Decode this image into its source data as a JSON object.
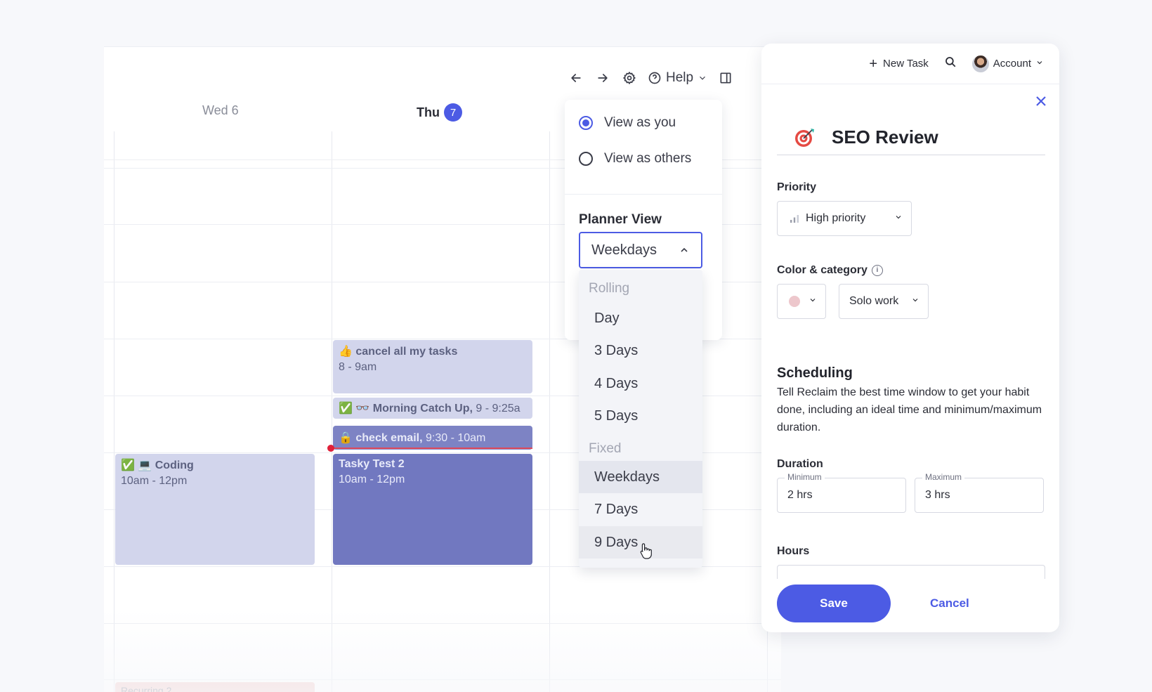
{
  "calendar": {
    "days": [
      {
        "name": "Wed 6"
      },
      {
        "name": "Thu",
        "badge": "7"
      }
    ],
    "events": [
      {
        "title": "👍 cancel all my tasks",
        "time": "8 - 9am"
      },
      {
        "title": "✅ 👓 Morning Catch Up,",
        "time": "9 - 9:25a"
      },
      {
        "title": "🔒 check email,",
        "time": "9:30 - 10am"
      },
      {
        "title": "Tasky Test 2",
        "time": "10am - 12pm"
      },
      {
        "title": "✅ 💻 Coding",
        "time": "10am - 12pm"
      },
      {
        "title": "Recurring 2"
      }
    ],
    "help_label": "Help",
    "icons": [
      "arrow-left-icon",
      "arrow-right-icon",
      "gear-icon",
      "question-circle-icon",
      "chevron-down-icon",
      "sidebar-panel-icon"
    ]
  },
  "view_popover": {
    "options": [
      {
        "label": "View as you",
        "selected": true
      },
      {
        "label": "View as others",
        "selected": false
      }
    ],
    "planner_label": "Planner View",
    "planner_value": "Weekdays"
  },
  "planner_dropdown": {
    "groups": [
      {
        "label": "Rolling",
        "items": [
          "Day",
          "3 Days",
          "4 Days",
          "5 Days"
        ]
      },
      {
        "label": "Fixed",
        "items": [
          "Weekdays",
          "7 Days",
          "9 Days"
        ]
      }
    ],
    "selected": "Weekdays",
    "hovered": "9 Days"
  },
  "panel": {
    "new_task": "New Task",
    "account": "Account",
    "task_title": "SEO Review",
    "task_icon": "target-dart-icon",
    "priority": {
      "label": "Priority",
      "value": "High priority"
    },
    "color_category": {
      "label": "Color & category",
      "color": "#edc7cc",
      "category": "Solo work"
    },
    "scheduling": {
      "title": "Scheduling",
      "description": "Tell Reclaim the best time window to get your habit done, including an ideal time and minimum/maximum duration."
    },
    "duration": {
      "label": "Duration",
      "min_label": "Minimum",
      "min_value": "2 hrs",
      "max_label": "Maximum",
      "max_value": "3 hrs"
    },
    "hours_label": "Hours",
    "save": "Save",
    "cancel": "Cancel"
  },
  "colors": {
    "accent": "#4c5be4",
    "event_light": "#d2d5ec",
    "event_dark": "#7178c0",
    "now_line": "#e04a5a"
  }
}
